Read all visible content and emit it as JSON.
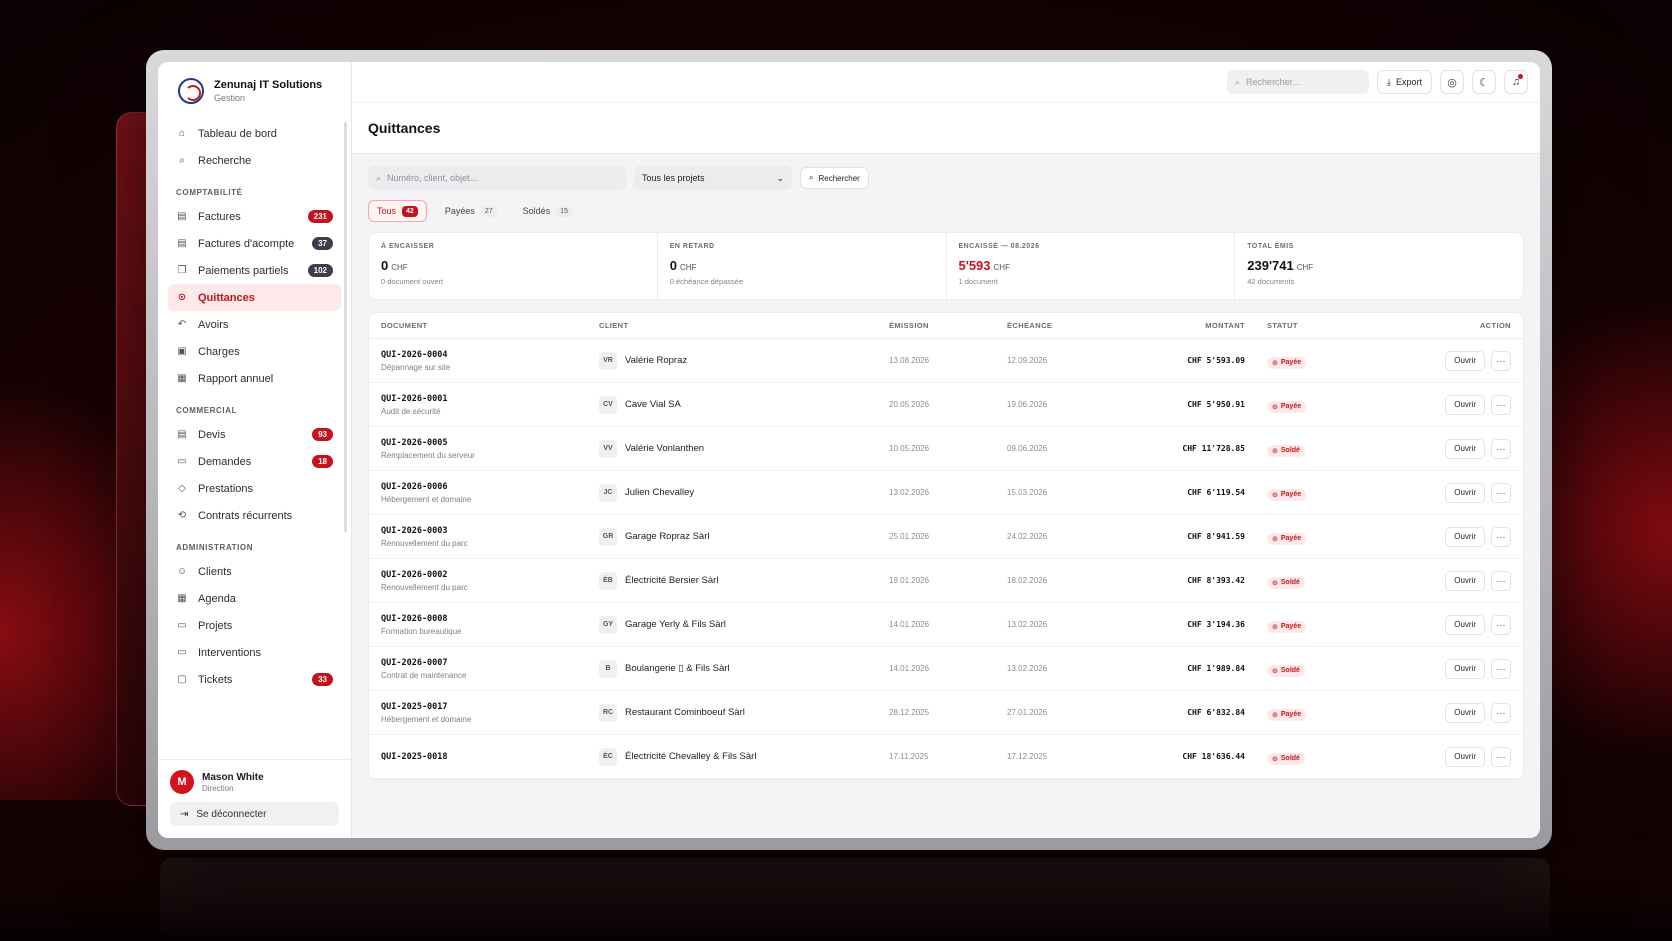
{
  "app": {
    "company": "Zenunaj IT Solutions",
    "subtitle": "Gestion"
  },
  "nav": {
    "top": [
      {
        "label": "Tableau de bord",
        "icon": "home-icon"
      },
      {
        "label": "Recherche",
        "icon": "search-icon"
      }
    ],
    "sections": [
      {
        "title": "COMPTABILITÉ",
        "items": [
          {
            "label": "Factures",
            "badge": "231",
            "badge_style": "red",
            "icon": "invoice-icon"
          },
          {
            "label": "Factures d'acompte",
            "badge": "37",
            "badge_style": "dark",
            "icon": "invoice-icon"
          },
          {
            "label": "Paiements partiels",
            "badge": "102",
            "badge_style": "dark",
            "icon": "copy-icon"
          },
          {
            "label": "Quittances",
            "badge": "",
            "active": true,
            "icon": "receipt-icon"
          },
          {
            "label": "Avoirs",
            "badge": "",
            "icon": "undo-icon"
          },
          {
            "label": "Charges",
            "badge": "",
            "icon": "wallet-icon"
          },
          {
            "label": "Rapport annuel",
            "badge": "",
            "icon": "report-icon"
          }
        ]
      },
      {
        "title": "COMMERCIAL",
        "items": [
          {
            "label": "Devis",
            "badge": "93",
            "badge_style": "red",
            "icon": "quote-icon"
          },
          {
            "label": "Demandes",
            "badge": "18",
            "badge_style": "red",
            "icon": "inbox-icon"
          },
          {
            "label": "Prestations",
            "badge": "",
            "icon": "tag-icon"
          },
          {
            "label": "Contrats récurrents",
            "badge": "",
            "icon": "repeat-icon"
          }
        ]
      },
      {
        "title": "ADMINISTRATION",
        "items": [
          {
            "label": "Clients",
            "badge": "",
            "icon": "users-icon"
          },
          {
            "label": "Agenda",
            "badge": "",
            "icon": "calendar-icon"
          },
          {
            "label": "Projets",
            "badge": "",
            "icon": "folder-icon"
          },
          {
            "label": "Interventions",
            "badge": "",
            "icon": "folder-icon"
          },
          {
            "label": "Tickets",
            "badge": "33",
            "badge_style": "red",
            "icon": "ticket-icon"
          }
        ]
      }
    ]
  },
  "user": {
    "initial": "M",
    "name": "Mason White",
    "role": "Direction",
    "logout": "Se déconnecter"
  },
  "topbar": {
    "search_placeholder": "Rechercher...",
    "export_label": "Export"
  },
  "page": {
    "title": "Quittances"
  },
  "filters": {
    "search_placeholder": "Numéro, client, objet...",
    "project_select": "Tous les projets",
    "search_button": "Rechercher"
  },
  "tabs": [
    {
      "label": "Tous",
      "count": "42",
      "active": true
    },
    {
      "label": "Payées",
      "count": "27"
    },
    {
      "label": "Soldés",
      "count": "15"
    }
  ],
  "stats": [
    {
      "label": "À ENCAISSER",
      "value": "0",
      "unit": "CHF",
      "sub": "0 document ouvert",
      "highlight": false
    },
    {
      "label": "EN RETARD",
      "value": "0",
      "unit": "CHF",
      "sub": "0 échéance dépassée",
      "highlight": false
    },
    {
      "label": "ENCAISSÉ — 08.2026",
      "value": "5'593",
      "unit": "CHF",
      "sub": "1 document",
      "highlight": true
    },
    {
      "label": "TOTAL ÉMIS",
      "value": "239'741",
      "unit": "CHF",
      "sub": "42 documents",
      "highlight": false
    }
  ],
  "table": {
    "headers": {
      "document": "DOCUMENT",
      "client": "CLIENT",
      "emission": "ÉMISSION",
      "echeance": "ÉCHÉANCE",
      "montant": "MONTANT",
      "statut": "STATUT",
      "action": "ACTION"
    },
    "open_label": "Ouvrir",
    "more_label": "···",
    "rows": [
      {
        "num": "QUI-2026-0004",
        "desc": "Dépannage sur site",
        "initials": "VR",
        "client": "Valérie Ropraz",
        "emission": "13.08.2026",
        "echeance": "12.09.2026",
        "amount": "CHF 5'593.09",
        "status": "Payée"
      },
      {
        "num": "QUI-2026-0001",
        "desc": "Audit de sécurité",
        "initials": "CV",
        "client": "Cave Vial SA",
        "emission": "20.05.2026",
        "echeance": "19.06.2026",
        "amount": "CHF 5'950.91",
        "status": "Payée"
      },
      {
        "num": "QUI-2026-0005",
        "desc": "Remplacement du serveur",
        "initials": "VV",
        "client": "Valérie Vonlanthen",
        "emission": "10.05.2026",
        "echeance": "09.06.2026",
        "amount": "CHF 11'728.85",
        "status": "Soldé"
      },
      {
        "num": "QUI-2026-0006",
        "desc": "Hébergement et domaine",
        "initials": "JC",
        "client": "Julien Chevalley",
        "emission": "13.02.2026",
        "echeance": "15.03.2026",
        "amount": "CHF 6'119.54",
        "status": "Payée"
      },
      {
        "num": "QUI-2026-0003",
        "desc": "Renouvellement du parc",
        "initials": "GR",
        "client": "Garage Ropraz Sàrl",
        "emission": "25.01.2026",
        "echeance": "24.02.2026",
        "amount": "CHF 8'941.59",
        "status": "Payée"
      },
      {
        "num": "QUI-2026-0002",
        "desc": "Renouvellement du parc",
        "initials": "ÉB",
        "client": "Électricité Bersier Sàrl",
        "emission": "19.01.2026",
        "echeance": "18.02.2026",
        "amount": "CHF 8'393.42",
        "status": "Soldé"
      },
      {
        "num": "QUI-2026-0008",
        "desc": "Formation bureautique",
        "initials": "GY",
        "client": "Garage Yerly & Fils Sàrl",
        "emission": "14.01.2026",
        "echeance": "13.02.2026",
        "amount": "CHF 3'194.36",
        "status": "Payée"
      },
      {
        "num": "QUI-2026-0007",
        "desc": "Contrat de maintenance",
        "initials": "B",
        "client": "Boulangerie ▯ & Fils Sàrl",
        "emission": "14.01.2026",
        "echeance": "13.02.2026",
        "amount": "CHF 1'989.84",
        "status": "Soldé"
      },
      {
        "num": "QUI-2025-0017",
        "desc": "Hébergement et domaine",
        "initials": "RC",
        "client": "Restaurant Cominboeuf Sàrl",
        "emission": "28.12.2025",
        "echeance": "27.01.2026",
        "amount": "CHF 6'832.84",
        "status": "Payée"
      },
      {
        "num": "QUI-2025-0018",
        "desc": "",
        "initials": "ÉC",
        "client": "Électricité Chevalley & Fils Sàrl",
        "emission": "17.11.2025",
        "echeance": "17.12.2025",
        "amount": "CHF 18'636.44",
        "status": "Soldé"
      }
    ]
  },
  "colors": {
    "accent": "#c2141d",
    "background": "#1e0305"
  }
}
